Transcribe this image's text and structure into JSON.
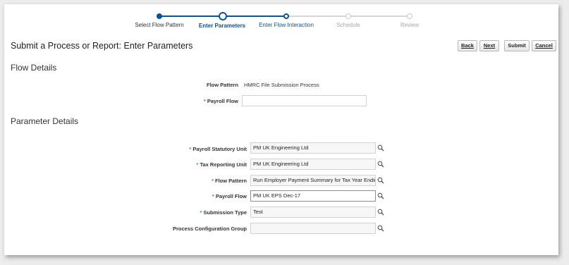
{
  "train": {
    "steps": [
      {
        "label": "Select Flow Pattern",
        "state": "done"
      },
      {
        "label": "Enter Parameters",
        "state": "current"
      },
      {
        "label": "Enter Flow Interaction",
        "state": "next"
      },
      {
        "label": "Schedule",
        "state": "future"
      },
      {
        "label": "Review",
        "state": "future"
      }
    ]
  },
  "page": {
    "title": "Submit a Process or Report: Enter Parameters"
  },
  "toolbar": {
    "back": "Back",
    "next": "Next",
    "submit": "Submit",
    "cancel": "Cancel"
  },
  "flow_details": {
    "title": "Flow Details",
    "flow_pattern_label": "Flow Pattern",
    "flow_pattern_value": "HMRC File Submission Process",
    "payroll_flow_label": "Payroll Flow",
    "payroll_flow_value": ""
  },
  "parameter_details": {
    "title": "Parameter Details",
    "fields": [
      {
        "label": "Payroll Statutory Unit",
        "value": "PM UK Engineering Ltd",
        "required": true
      },
      {
        "label": "Tax Reporting Unit",
        "value": "PM UK Engineering Ltd",
        "required": true
      },
      {
        "label": "Flow Pattern",
        "value": "Run Employer Payment Summary for Tax Year Ending",
        "required": true
      },
      {
        "label": "Payroll Flow",
        "value": "PM UK EPS Dec-17",
        "required": true
      },
      {
        "label": "Submission Type",
        "value": "Test",
        "required": true
      },
      {
        "label": "Process Configuration Group",
        "value": "",
        "required": false
      }
    ]
  },
  "required_marker": "*",
  "colors": {
    "accent": "#0b5394",
    "future": "#c9c9c9",
    "required": "#3a87c9"
  },
  "icons": {
    "lookup": "magnifier-icon"
  }
}
